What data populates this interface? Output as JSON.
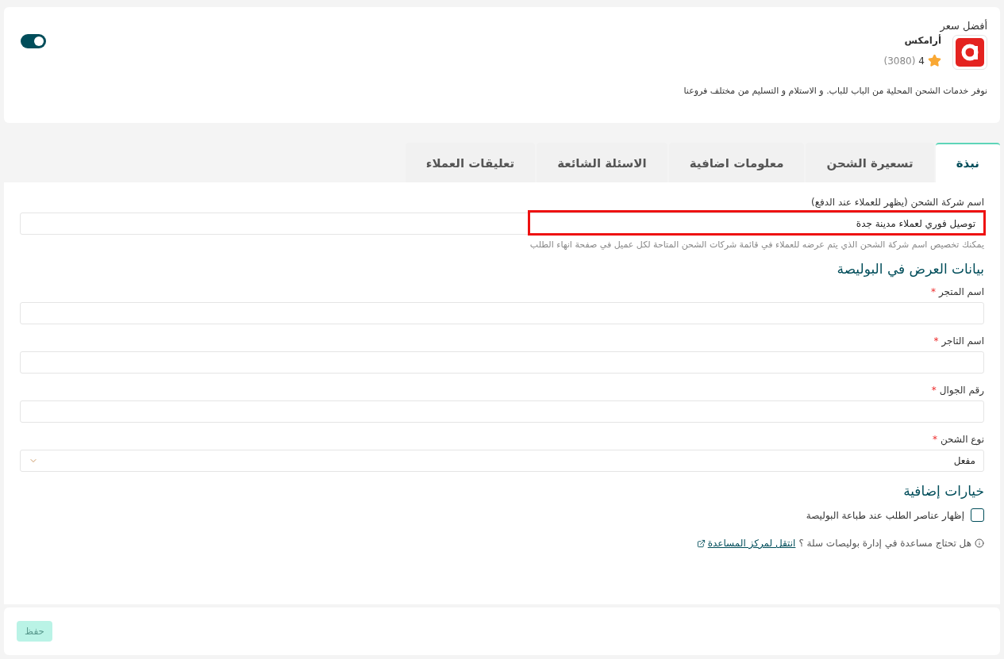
{
  "company": {
    "badge": "أفضل سعر",
    "name": "أرامكس",
    "rating": "4",
    "reviews": "(3080)",
    "description": "نوفر خدمات الشحن المحلية من الباب للباب. و الاستلام و التسليم من مختلف فروعنا",
    "enabled": true
  },
  "tabs": [
    {
      "label": "نبذة",
      "selected": true
    },
    {
      "label": "تسعيرة الشحن",
      "selected": false
    },
    {
      "label": "معلومات اضافية",
      "selected": false
    },
    {
      "label": "الاسئلة الشائعة",
      "selected": false
    },
    {
      "label": "تعليقات العملاء",
      "selected": false
    }
  ],
  "name_field": {
    "label": "اسم شركة الشحن (يظهر للعملاء عند الدفع)",
    "value": "توصيل فوري لعملاء مدينة جدة",
    "hint": "يمكنك تخصيص اسم شركة الشحن الذي يتم عرضه للعملاء في قائمة شركات الشحن المتاحة لكل عميل في صفحة انهاء الطلب",
    "highlighted": true
  },
  "policy_section": {
    "title": "بيانات العرض في البوليصة",
    "fields": [
      {
        "kind": "text",
        "label": "اسم المتجر",
        "required_mark": "*"
      },
      {
        "kind": "text",
        "label": "اسم التاجر",
        "required_mark": "*"
      },
      {
        "kind": "text",
        "label": "رقم الجوال",
        "required_mark": "*"
      },
      {
        "kind": "select",
        "label": "نوع الشحن",
        "required_mark": "*",
        "value": "مفعل"
      }
    ]
  },
  "options_section": {
    "title": "خيارات إضافية",
    "checkbox": {
      "label": "إظهار عناصر الطلب عند طباعة البوليصة",
      "checked": false
    }
  },
  "help": {
    "text": "هل تحتاج مساعدة في إدارة بوليصات سلة ؟",
    "link": "انتقل لمركز المساعدة"
  },
  "save_button": "حفظ"
}
